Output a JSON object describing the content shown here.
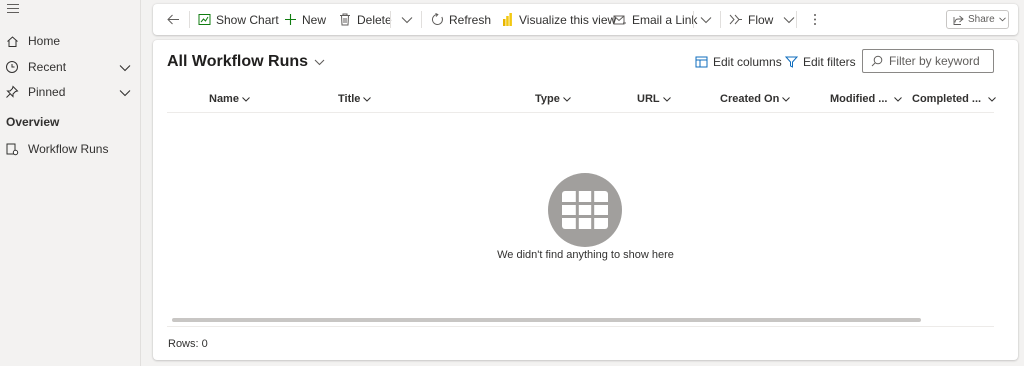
{
  "sidebar": {
    "items": [
      {
        "label": "Home",
        "icon": "home-icon"
      },
      {
        "label": "Recent",
        "icon": "clock-icon"
      },
      {
        "label": "Pinned",
        "icon": "pin-icon"
      }
    ],
    "section_title": "Overview",
    "section_items": [
      {
        "label": "Workflow Runs",
        "icon": "workflow-runs-icon"
      }
    ]
  },
  "commandbar": {
    "show_chart": "Show Chart",
    "new": "New",
    "delete": "Delete",
    "refresh": "Refresh",
    "visualize": "Visualize this view",
    "email_link": "Email a Link",
    "flow": "Flow",
    "share": "Share"
  },
  "view": {
    "title": "All Workflow Runs",
    "edit_columns": "Edit columns",
    "edit_filters": "Edit filters",
    "filter_placeholder": "Filter by keyword",
    "columns": [
      "Name",
      "Title",
      "Type",
      "URL",
      "Created On",
      "Modified ...",
      "Completed ..."
    ],
    "empty_message": "We didn't find anything to show here",
    "rows_label": "Rows: 0"
  },
  "colors": {
    "accent": "#0f6cbd",
    "new_green": "#107c10",
    "powerbi_yellow": "#f2c811",
    "empty_icon_gray": "#a19f9d"
  }
}
